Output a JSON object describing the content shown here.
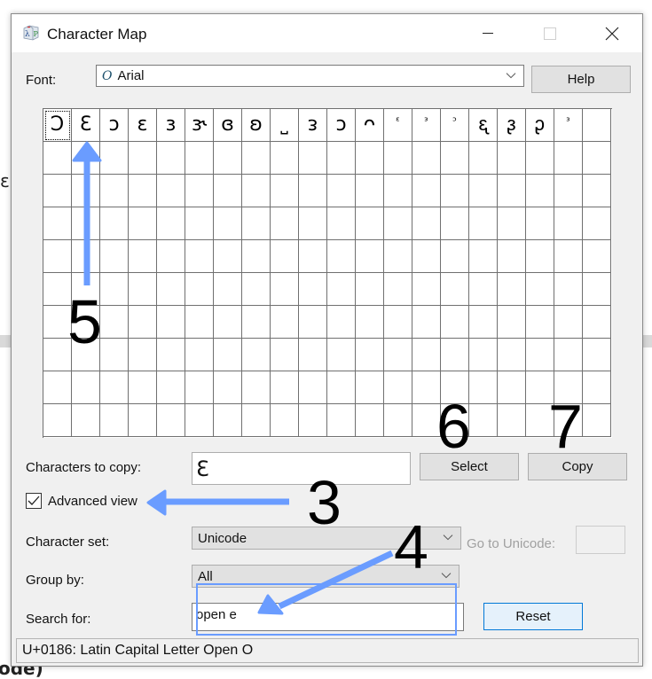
{
  "window": {
    "title": "Character Map",
    "controls": {
      "minimize": "minimize",
      "maximize": "maximize",
      "close": "close"
    }
  },
  "font": {
    "label": "Font:",
    "selected": "Arial",
    "font_type_glyph": "O",
    "help_label": "Help"
  },
  "grid": {
    "columns": 20,
    "rows": 10,
    "selected_index": 0,
    "characters": [
      "Ɔ",
      "Ɛ",
      "ɔ",
      "ɛ",
      "ɜ",
      "ɝ",
      "ɞ",
      "ʚ",
      "˽",
      "ᴈ",
      "ᴐ",
      "ᴖ",
      "ᵋ",
      "ᵌ",
      "ᵓ",
      "ᶓ",
      "ᶔ",
      "ᶗ",
      "ᶟ",
      ""
    ],
    "small_indices": [
      12,
      13,
      14,
      18
    ]
  },
  "copy": {
    "label": "Characters to copy:",
    "value": "Ɛ",
    "select_label": "Select",
    "copy_label": "Copy"
  },
  "advanced_view": {
    "label": "Advanced view",
    "checked": true
  },
  "character_set": {
    "label": "Character set:",
    "selected": "Unicode"
  },
  "go_to_unicode": {
    "label": "Go to Unicode:",
    "value": ""
  },
  "group_by": {
    "label": "Group by:",
    "selected": "All"
  },
  "search": {
    "label": "Search for:",
    "value": "open e",
    "reset_label": "Reset"
  },
  "status": {
    "text": "U+0186: Latin Capital Letter Open O"
  },
  "annotations": {
    "color": "#6a9cff",
    "steps": [
      "3",
      "4",
      "5",
      "6",
      "7"
    ]
  },
  "background": {
    "fragment_left": "ɛ",
    "fragment_bottom": "ode)"
  }
}
